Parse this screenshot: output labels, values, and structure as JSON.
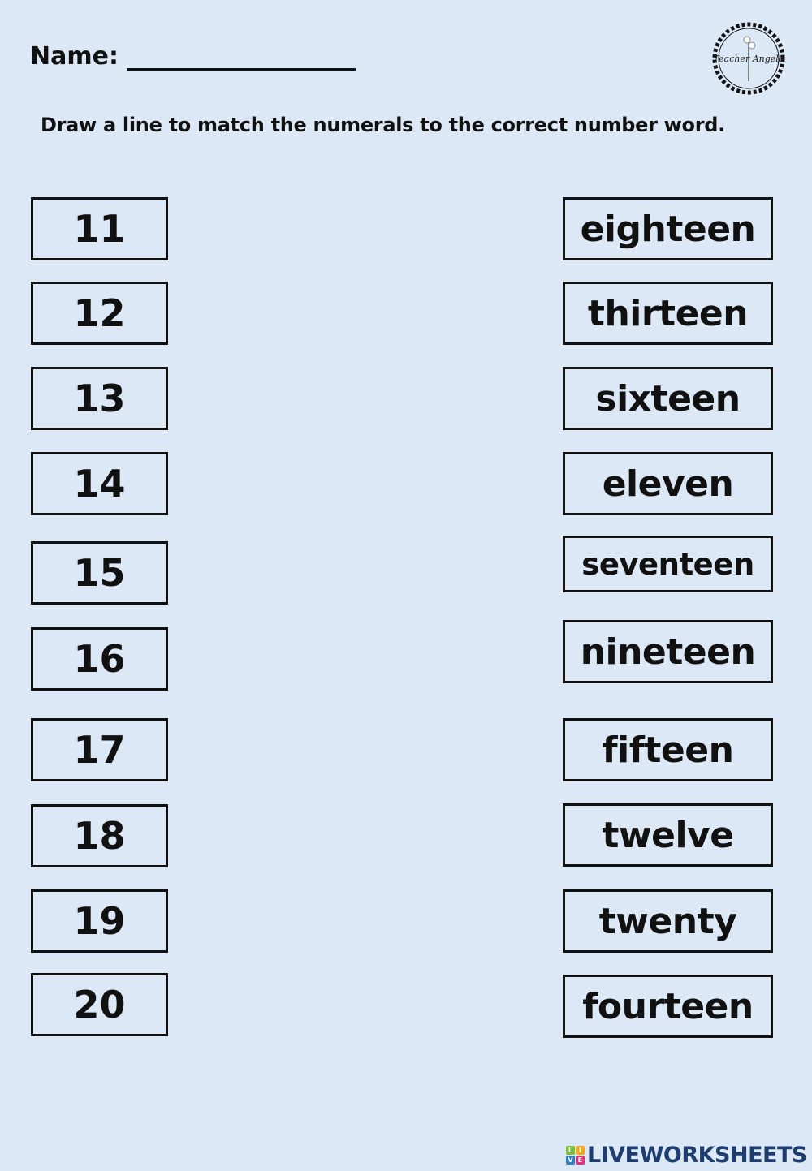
{
  "header": {
    "name_label": "Name:",
    "instruction": "Draw a line to match the numerals to the correct number word.",
    "logo_text": "Teacher Angela"
  },
  "numerals": [
    "11",
    "12",
    "13",
    "14",
    "15",
    "16",
    "17",
    "18",
    "19",
    "20"
  ],
  "words": [
    "eighteen",
    "thirteen",
    "sixteen",
    "eleven",
    "seventeen",
    "nineteen",
    "fifteen",
    "twelve",
    "twenty",
    "fourteen"
  ],
  "footer": {
    "brand": "LIVEWORKSHEETS",
    "badge_letters": [
      "L",
      "I",
      "V",
      "E"
    ],
    "badge_colors": [
      "#7bbf3a",
      "#f2a81d",
      "#2f7fd1",
      "#e0327a"
    ],
    "brand_color": "#1c3d6e"
  }
}
